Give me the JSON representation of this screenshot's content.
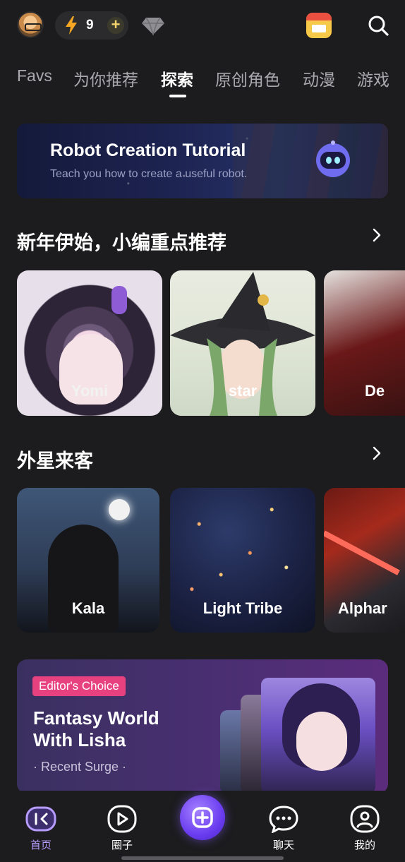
{
  "header": {
    "energy_count": "9",
    "icons": [
      "avatar",
      "bolt-icon",
      "plus-icon",
      "diamond-icon",
      "calendar-icon",
      "search-icon"
    ]
  },
  "tabs": [
    {
      "label": "Favs",
      "active": false
    },
    {
      "label": "为你推荐",
      "active": false
    },
    {
      "label": "探索",
      "active": true
    },
    {
      "label": "原创角色",
      "active": false
    },
    {
      "label": "动漫",
      "active": false
    },
    {
      "label": "游戏",
      "active": false
    }
  ],
  "banner": {
    "title": "Robot Creation Tutorial",
    "subtitle": "Teach you how to create a useful robot."
  },
  "sections": [
    {
      "title": "新年伊始，小编重点推荐",
      "cards": [
        {
          "label": "Yomi"
        },
        {
          "label": "star"
        },
        {
          "label": "De"
        }
      ]
    },
    {
      "title": "外星来客",
      "cards": [
        {
          "label": "Kala"
        },
        {
          "label": "Light Tribe"
        },
        {
          "label": "Alphar"
        }
      ]
    }
  ],
  "editor": {
    "badge": "Editor's Choice",
    "title_line1": "Fantasy World",
    "title_line2": "With Lisha",
    "subtitle": "· Recent Surge ·"
  },
  "nav": [
    {
      "label": "首页",
      "icon": "home-icon",
      "active": true
    },
    {
      "label": "圈子",
      "icon": "play-icon",
      "active": false
    },
    {
      "label": "",
      "icon": "add-icon",
      "active": false
    },
    {
      "label": "聊天",
      "icon": "chat-icon",
      "active": false
    },
    {
      "label": "我的",
      "icon": "profile-icon",
      "active": false
    }
  ],
  "colors": {
    "background": "#1c1c1e",
    "accent": "#7c4dff",
    "badge": "#e7427f",
    "active_nav": "#b79cff"
  }
}
